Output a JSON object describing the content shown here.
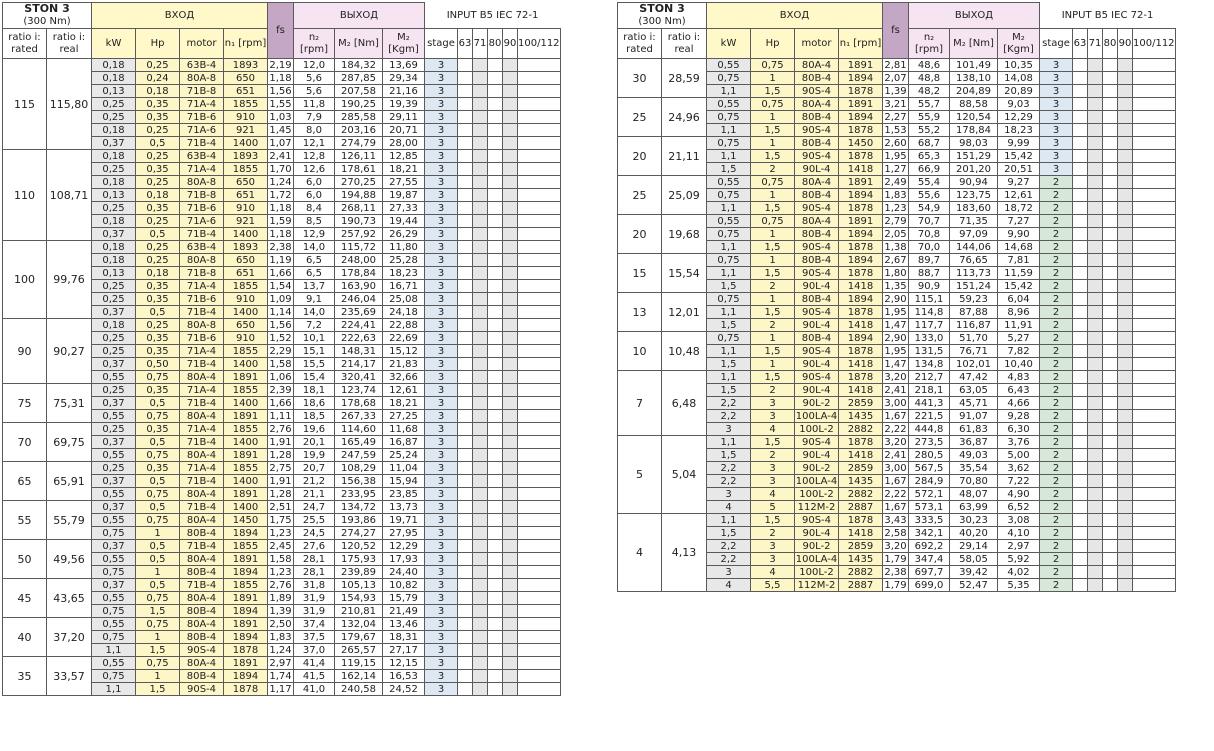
{
  "header": {
    "model": "STON 3",
    "torque": "(300 Nm)",
    "input_label": "ВХОД",
    "output_label": "ВЫХОД",
    "fs_label": "fs",
    "iec_label": "INPUT B5 IEC 72-1",
    "ratio_rated": "ratio i: rated",
    "ratio_real": "ratio i: real",
    "kw": "kW",
    "hp": "Hp",
    "motor": "motor",
    "n1": "n₁ [rpm]",
    "n2": "n₂ [rpm]",
    "m2nm": "M₂ [Nm]",
    "m2kgm": "M₂ [Kgm]",
    "stage": "stage",
    "iec_sizes": [
      "63",
      "71",
      "80",
      "90",
      "100/112"
    ]
  },
  "left_groups": [
    {
      "rated": "115",
      "real": "115,80",
      "rows": [
        [
          "0,18",
          "0,25",
          "63B-4",
          "1893",
          "2,19",
          "12,0",
          "184,32",
          "13,69",
          "3"
        ],
        [
          "0,18",
          "0,24",
          "80A-8",
          "650",
          "1,18",
          "5,6",
          "287,85",
          "29,34",
          "3"
        ],
        [
          "0,13",
          "0,18",
          "71B-8",
          "651",
          "1,56",
          "5,6",
          "207,58",
          "21,16",
          "3"
        ],
        [
          "0,25",
          "0,35",
          "71A-4",
          "1855",
          "1,55",
          "11,8",
          "190,25",
          "19,39",
          "3"
        ],
        [
          "0,25",
          "0,35",
          "71B-6",
          "910",
          "1,03",
          "7,9",
          "285,58",
          "29,11",
          "3"
        ],
        [
          "0,18",
          "0,25",
          "71A-6",
          "921",
          "1,45",
          "8,0",
          "203,16",
          "20,71",
          "3"
        ],
        [
          "0,37",
          "0,5",
          "71B-4",
          "1400",
          "1,07",
          "12,1",
          "274,79",
          "28,00",
          "3"
        ]
      ]
    },
    {
      "rated": "110",
      "real": "108,71",
      "rows": [
        [
          "0,18",
          "0,25",
          "63B-4",
          "1893",
          "2,41",
          "12,8",
          "126,11",
          "12,85",
          "3"
        ],
        [
          "0,25",
          "0,35",
          "71A-4",
          "1855",
          "1,70",
          "12,6",
          "178,61",
          "18,21",
          "3"
        ],
        [
          "0,18",
          "0,25",
          "80A-8",
          "650",
          "1,24",
          "6,0",
          "270,25",
          "27,55",
          "3"
        ],
        [
          "0,13",
          "0,18",
          "71B-8",
          "651",
          "1,72",
          "6,0",
          "194,88",
          "19,87",
          "3"
        ],
        [
          "0,25",
          "0,35",
          "71B-6",
          "910",
          "1,18",
          "8,4",
          "268,11",
          "27,33",
          "3"
        ],
        [
          "0,18",
          "0,25",
          "71A-6",
          "921",
          "1,59",
          "8,5",
          "190,73",
          "19,44",
          "3"
        ],
        [
          "0,37",
          "0,5",
          "71B-4",
          "1400",
          "1,18",
          "12,9",
          "257,92",
          "26,29",
          "3"
        ]
      ]
    },
    {
      "rated": "100",
      "real": "99,76",
      "rows": [
        [
          "0,18",
          "0,25",
          "63B-4",
          "1893",
          "2,38",
          "14,0",
          "115,72",
          "11,80",
          "3"
        ],
        [
          "0,18",
          "0,25",
          "80A-8",
          "650",
          "1,19",
          "6,5",
          "248,00",
          "25,28",
          "3"
        ],
        [
          "0,13",
          "0,18",
          "71B-8",
          "651",
          "1,66",
          "6,5",
          "178,84",
          "18,23",
          "3"
        ],
        [
          "0,25",
          "0,35",
          "71A-4",
          "1855",
          "1,54",
          "13,7",
          "163,90",
          "16,71",
          "3"
        ],
        [
          "0,25",
          "0,35",
          "71B-6",
          "910",
          "1,09",
          "9,1",
          "246,04",
          "25,08",
          "3"
        ],
        [
          "0,37",
          "0,5",
          "71B-4",
          "1400",
          "1,14",
          "14,0",
          "235,69",
          "24,18",
          "3"
        ]
      ]
    },
    {
      "rated": "90",
      "real": "90,27",
      "rows": [
        [
          "0,18",
          "0,25",
          "80A-8",
          "650",
          "1,56",
          "7,2",
          "224,41",
          "22,88",
          "3"
        ],
        [
          "0,25",
          "0,35",
          "71B-6",
          "910",
          "1,52",
          "10,1",
          "222,63",
          "22,69",
          "3"
        ],
        [
          "0,25",
          "0,35",
          "71A-4",
          "1855",
          "2,29",
          "15,1",
          "148,31",
          "15,12",
          "3"
        ],
        [
          "0,37",
          "0,50",
          "71B-4",
          "1400",
          "1,58",
          "15,5",
          "214,17",
          "21,83",
          "3"
        ],
        [
          "0,55",
          "0,75",
          "80A-4",
          "1891",
          "1,06",
          "15,4",
          "320,41",
          "32,66",
          "3"
        ]
      ]
    },
    {
      "rated": "75",
      "real": "75,31",
      "rows": [
        [
          "0,25",
          "0,35",
          "71A-4",
          "1855",
          "2,39",
          "18,1",
          "123,74",
          "12,61",
          "3"
        ],
        [
          "0,37",
          "0,5",
          "71B-4",
          "1400",
          "1,66",
          "18,6",
          "178,68",
          "18,21",
          "3"
        ],
        [
          "0,55",
          "0,75",
          "80A-4",
          "1891",
          "1,11",
          "18,5",
          "267,33",
          "27,25",
          "3"
        ]
      ]
    },
    {
      "rated": "70",
      "real": "69,75",
      "rows": [
        [
          "0,25",
          "0,35",
          "71A-4",
          "1855",
          "2,76",
          "19,6",
          "114,60",
          "11,68",
          "3"
        ],
        [
          "0,37",
          "0,5",
          "71B-4",
          "1400",
          "1,91",
          "20,1",
          "165,49",
          "16,87",
          "3"
        ],
        [
          "0,55",
          "0,75",
          "80A-4",
          "1891",
          "1,28",
          "19,9",
          "247,59",
          "25,24",
          "3"
        ]
      ]
    },
    {
      "rated": "65",
      "real": "65,91",
      "rows": [
        [
          "0,25",
          "0,35",
          "71A-4",
          "1855",
          "2,75",
          "20,7",
          "108,29",
          "11,04",
          "3"
        ],
        [
          "0,37",
          "0,5",
          "71B-4",
          "1400",
          "1,91",
          "21,2",
          "156,38",
          "15,94",
          "3"
        ],
        [
          "0,55",
          "0,75",
          "80A-4",
          "1891",
          "1,28",
          "21,1",
          "233,95",
          "23,85",
          "3"
        ]
      ]
    },
    {
      "rated": "55",
      "real": "55,79",
      "rows": [
        [
          "0,37",
          "0,5",
          "71B-4",
          "1400",
          "2,51",
          "24,7",
          "134,72",
          "13,73",
          "3"
        ],
        [
          "0,55",
          "0,75",
          "80A-4",
          "1450",
          "1,75",
          "25,5",
          "193,86",
          "19,71",
          "3"
        ],
        [
          "0,75",
          "1",
          "80B-4",
          "1894",
          "1,23",
          "24,5",
          "274,27",
          "27,95",
          "3"
        ]
      ]
    },
    {
      "rated": "50",
      "real": "49,56",
      "rows": [
        [
          "0,37",
          "0,5",
          "71B-4",
          "1855",
          "2,45",
          "27,6",
          "120,52",
          "12,29",
          "3"
        ],
        [
          "0,55",
          "0,5",
          "80A-4",
          "1891",
          "1,58",
          "28,1",
          "175,93",
          "17,93",
          "3"
        ],
        [
          "0,75",
          "1",
          "80B-4",
          "1894",
          "1,23",
          "28,1",
          "239,89",
          "24,40",
          "3"
        ]
      ]
    },
    {
      "rated": "45",
      "real": "43,65",
      "rows": [
        [
          "0,37",
          "0,5",
          "71B-4",
          "1855",
          "2,76",
          "31,8",
          "105,13",
          "10,82",
          "3"
        ],
        [
          "0,55",
          "0,75",
          "80A-4",
          "1891",
          "1,89",
          "31,9",
          "154,93",
          "15,79",
          "3"
        ],
        [
          "0,75",
          "1,5",
          "80B-4",
          "1894",
          "1,39",
          "31,9",
          "210,81",
          "21,49",
          "3"
        ]
      ]
    },
    {
      "rated": "40",
      "real": "37,20",
      "rows": [
        [
          "0,55",
          "0,75",
          "80A-4",
          "1891",
          "2,50",
          "37,4",
          "132,04",
          "13,46",
          "3"
        ],
        [
          "0,75",
          "1",
          "80B-4",
          "1894",
          "1,83",
          "37,5",
          "179,67",
          "18,31",
          "3"
        ],
        [
          "1,1",
          "1,5",
          "90S-4",
          "1878",
          "1,24",
          "37,0",
          "265,57",
          "27,17",
          "3"
        ]
      ]
    },
    {
      "rated": "35",
      "real": "33,57",
      "rows": [
        [
          "0,55",
          "0,75",
          "80A-4",
          "1891",
          "2,97",
          "41,4",
          "119,15",
          "12,15",
          "3"
        ],
        [
          "0,75",
          "1",
          "80B-4",
          "1894",
          "1,74",
          "41,5",
          "162,14",
          "16,53",
          "3"
        ],
        [
          "1,1",
          "1,5",
          "90S-4",
          "1878",
          "1,17",
          "41,0",
          "240,58",
          "24,52",
          "3"
        ]
      ]
    }
  ],
  "right_groups": [
    {
      "rated": "30",
      "real": "28,59",
      "rows": [
        [
          "0,55",
          "0,75",
          "80A-4",
          "1891",
          "2,81",
          "48,6",
          "101,49",
          "10,35",
          "3"
        ],
        [
          "0,75",
          "1",
          "80B-4",
          "1894",
          "2,07",
          "48,8",
          "138,10",
          "14,08",
          "3"
        ],
        [
          "1,1",
          "1,5",
          "90S-4",
          "1878",
          "1,39",
          "48,2",
          "204,89",
          "20,89",
          "3"
        ]
      ]
    },
    {
      "rated": "25",
      "real": "24,96",
      "rows": [
        [
          "0,55",
          "0,75",
          "80A-4",
          "1891",
          "3,21",
          "55,7",
          "88,58",
          "9,03",
          "3"
        ],
        [
          "0,75",
          "1",
          "80B-4",
          "1894",
          "2,27",
          "55,9",
          "120,54",
          "12,29",
          "3"
        ],
        [
          "1,1",
          "1,5",
          "90S-4",
          "1878",
          "1,53",
          "55,2",
          "178,84",
          "18,23",
          "3"
        ]
      ]
    },
    {
      "rated": "20",
      "real": "21,11",
      "rows": [
        [
          "0,75",
          "1",
          "80B-4",
          "1450",
          "2,60",
          "68,7",
          "98,03",
          "9,99",
          "3"
        ],
        [
          "1,1",
          "1,5",
          "90S-4",
          "1878",
          "1,95",
          "65,3",
          "151,29",
          "15,42",
          "3"
        ],
        [
          "1,5",
          "2",
          "90L-4",
          "1418",
          "1,27",
          "66,9",
          "201,20",
          "20,51",
          "3"
        ]
      ]
    },
    {
      "rated": "25",
      "real": "25,09",
      "rows": [
        [
          "0,55",
          "0,75",
          "80A-4",
          "1891",
          "2,49",
          "55,4",
          "90,94",
          "9,27",
          "2"
        ],
        [
          "0,75",
          "1",
          "80B-4",
          "1894",
          "1,83",
          "55,6",
          "123,75",
          "12,61",
          "2"
        ],
        [
          "1,1",
          "1,5",
          "90S-4",
          "1878",
          "1,23",
          "54,9",
          "183,60",
          "18,72",
          "2"
        ]
      ]
    },
    {
      "rated": "20",
      "real": "19,68",
      "rows": [
        [
          "0,55",
          "0,75",
          "80A-4",
          "1891",
          "2,79",
          "70,7",
          "71,35",
          "7,27",
          "2"
        ],
        [
          "0,75",
          "1",
          "80B-4",
          "1894",
          "2,05",
          "70,8",
          "97,09",
          "9,90",
          "2"
        ],
        [
          "1,1",
          "1,5",
          "90S-4",
          "1878",
          "1,38",
          "70,0",
          "144,06",
          "14,68",
          "2"
        ]
      ]
    },
    {
      "rated": "15",
      "real": "15,54",
      "rows": [
        [
          "0,75",
          "1",
          "80B-4",
          "1894",
          "2,67",
          "89,7",
          "76,65",
          "7,81",
          "2"
        ],
        [
          "1,1",
          "1,5",
          "90S-4",
          "1878",
          "1,80",
          "88,7",
          "113,73",
          "11,59",
          "2"
        ],
        [
          "1,5",
          "2",
          "90L-4",
          "1418",
          "1,35",
          "90,9",
          "151,24",
          "15,42",
          "2"
        ]
      ]
    },
    {
      "rated": "13",
      "real": "12,01",
      "rows": [
        [
          "0,75",
          "1",
          "80B-4",
          "1894",
          "2,90",
          "115,1",
          "59,23",
          "6,04",
          "2"
        ],
        [
          "1,1",
          "1,5",
          "90S-4",
          "1878",
          "1,95",
          "114,8",
          "87,88",
          "8,96",
          "2"
        ],
        [
          "1,5",
          "2",
          "90L-4",
          "1418",
          "1,47",
          "117,7",
          "116,87",
          "11,91",
          "2"
        ]
      ]
    },
    {
      "rated": "10",
      "real": "10,48",
      "rows": [
        [
          "0,75",
          "1",
          "80B-4",
          "1894",
          "2,90",
          "133,0",
          "51,70",
          "5,27",
          "2"
        ],
        [
          "1,1",
          "1,5",
          "90S-4",
          "1878",
          "1,95",
          "131,5",
          "76,71",
          "7,82",
          "2"
        ],
        [
          "1,5",
          "1",
          "90L-4",
          "1418",
          "1,47",
          "134,8",
          "102,01",
          "10,40",
          "2"
        ]
      ]
    },
    {
      "rated": "7",
      "real": "6,48",
      "rows": [
        [
          "1,1",
          "1,5",
          "90S-4",
          "1878",
          "3,20",
          "212,7",
          "47,42",
          "4,83",
          "2"
        ],
        [
          "1,5",
          "2",
          "90L-4",
          "1418",
          "2,41",
          "218,1",
          "63,05",
          "6,43",
          "2"
        ],
        [
          "2,2",
          "3",
          "90L-2",
          "2859",
          "3,00",
          "441,3",
          "45,71",
          "4,66",
          "2"
        ],
        [
          "2,2",
          "3",
          "100LA-4",
          "1435",
          "1,67",
          "221,5",
          "91,07",
          "9,28",
          "2"
        ],
        [
          "3",
          "4",
          "100L-2",
          "2882",
          "2,22",
          "444,8",
          "61,83",
          "6,30",
          "2"
        ]
      ]
    },
    {
      "rated": "5",
      "real": "5,04",
      "rows": [
        [
          "1,1",
          "1,5",
          "90S-4",
          "1878",
          "3,20",
          "273,5",
          "36,87",
          "3,76",
          "2"
        ],
        [
          "1,5",
          "2",
          "90L-4",
          "1418",
          "2,41",
          "280,5",
          "49,03",
          "5,00",
          "2"
        ],
        [
          "2,2",
          "3",
          "90L-2",
          "2859",
          "3,00",
          "567,5",
          "35,54",
          "3,62",
          "2"
        ],
        [
          "2,2",
          "3",
          "100LA-4",
          "1435",
          "1,67",
          "284,9",
          "70,80",
          "7,22",
          "2"
        ],
        [
          "3",
          "4",
          "100L-2",
          "2882",
          "2,22",
          "572,1",
          "48,07",
          "4,90",
          "2"
        ],
        [
          "4",
          "5",
          "112M-2",
          "2887",
          "1,67",
          "573,1",
          "63,99",
          "6,52",
          "2"
        ]
      ]
    },
    {
      "rated": "4",
      "real": "4,13",
      "rows": [
        [
          "1,1",
          "1,5",
          "90S-4",
          "1878",
          "3,43",
          "333,5",
          "30,23",
          "3,08",
          "2"
        ],
        [
          "1,5",
          "2",
          "90L-4",
          "1418",
          "2,58",
          "342,1",
          "40,20",
          "4,10",
          "2"
        ],
        [
          "2,2",
          "3",
          "90L-2",
          "2859",
          "3,20",
          "692,2",
          "29,14",
          "2,97",
          "2"
        ],
        [
          "2,2",
          "3",
          "100LA-4",
          "1435",
          "1,79",
          "347,4",
          "58,05",
          "5,92",
          "2"
        ],
        [
          "3",
          "4",
          "100L-2",
          "2882",
          "2,38",
          "697,7",
          "39,42",
          "4,02",
          "2"
        ],
        [
          "4",
          "5,5",
          "112M-2",
          "2887",
          "1,79",
          "699,0",
          "52,47",
          "5,35",
          "2"
        ]
      ]
    }
  ]
}
